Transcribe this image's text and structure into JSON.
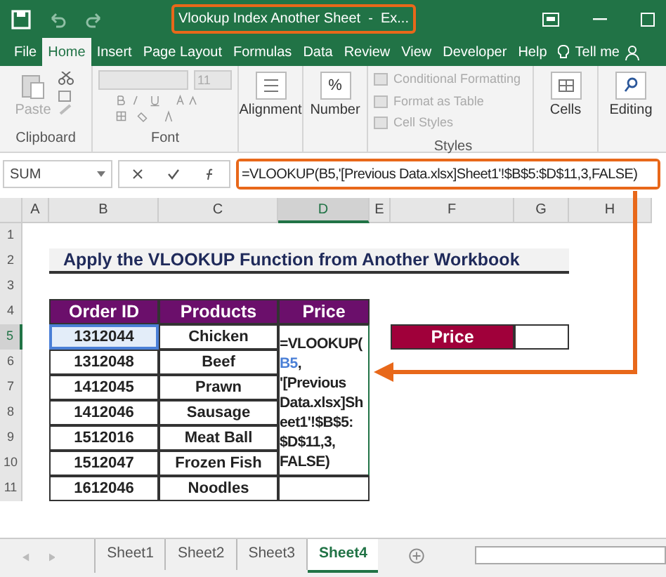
{
  "window": {
    "title": "Vlookup Index Another Sheet  -  Ex..."
  },
  "ribbon_tabs": [
    {
      "label": "File",
      "selected": false
    },
    {
      "label": "Home",
      "selected": true
    },
    {
      "label": "Insert",
      "selected": false
    },
    {
      "label": "Page Layout",
      "selected": false
    },
    {
      "label": "Formulas",
      "selected": false
    },
    {
      "label": "Data",
      "selected": false
    },
    {
      "label": "Review",
      "selected": false
    },
    {
      "label": "View",
      "selected": false
    },
    {
      "label": "Developer",
      "selected": false
    },
    {
      "label": "Help",
      "selected": false
    }
  ],
  "tell_me": "Tell me",
  "ribbon": {
    "paste": "Paste",
    "clipboard": "Clipboard",
    "font_size": "11",
    "font": "Font",
    "alignment": "Alignment",
    "number_symbol": "%",
    "number": "Number",
    "styles_items": [
      "Conditional Formatting",
      "Format as Table",
      "Cell Styles"
    ],
    "styles": "Styles",
    "cells": "Cells",
    "editing": "Editing"
  },
  "formula_bar": {
    "name_box": "SUM",
    "formula": "=VLOOKUP(B5,'[Previous Data.xlsx]Sheet1'!$B$5:$D$11,3,FALSE)"
  },
  "columns": [
    {
      "label": "A",
      "selected": false
    },
    {
      "label": "B",
      "selected": false
    },
    {
      "label": "C",
      "selected": false
    },
    {
      "label": "D",
      "selected": true
    },
    {
      "label": "E",
      "selected": false
    },
    {
      "label": "F",
      "selected": false
    },
    {
      "label": "G",
      "selected": false
    },
    {
      "label": "H",
      "selected": false
    }
  ],
  "rows": [
    {
      "label": "1",
      "selected": false
    },
    {
      "label": "2",
      "selected": false
    },
    {
      "label": "3",
      "selected": false
    },
    {
      "label": "4",
      "selected": false
    },
    {
      "label": "5",
      "selected": true
    },
    {
      "label": "6",
      "selected": false
    },
    {
      "label": "7",
      "selected": false
    },
    {
      "label": "8",
      "selected": false
    },
    {
      "label": "9",
      "selected": false
    },
    {
      "label": "10",
      "selected": false
    },
    {
      "label": "11",
      "selected": false
    }
  ],
  "sheet_title": "Apply the VLOOKUP Function from Another Workbook",
  "table": {
    "columns": [
      "Order ID",
      "Products",
      "Price"
    ],
    "rows": [
      {
        "order_id": "1312044",
        "product": "Chicken",
        "highlighted": true
      },
      {
        "order_id": "1312048",
        "product": "Beef",
        "highlighted": false
      },
      {
        "order_id": "1412045",
        "product": "Prawn",
        "highlighted": false
      },
      {
        "order_id": "1412046",
        "product": "Sausage",
        "highlighted": false
      },
      {
        "order_id": "1512016",
        "product": "Meat Ball",
        "highlighted": false
      },
      {
        "order_id": "1512047",
        "product": "Frozen Fish",
        "highlighted": false
      },
      {
        "order_id": "1612046",
        "product": "Noodles",
        "highlighted": false
      }
    ]
  },
  "editing_cell": {
    "head": "=VLOOKUP(",
    "reference": "B5",
    "rest": [
      ",",
      "'[Previous",
      "Data.xlsx]Sh",
      "eet1'!$B$5:",
      "$D$11,3,",
      "FALSE)"
    ]
  },
  "lookup": {
    "label": "Price"
  },
  "sheet_tabs": [
    {
      "label": "Sheet1",
      "selected": false
    },
    {
      "label": "Sheet2",
      "selected": false
    },
    {
      "label": "Sheet3",
      "selected": false
    },
    {
      "label": "Sheet4",
      "selected": true
    }
  ]
}
